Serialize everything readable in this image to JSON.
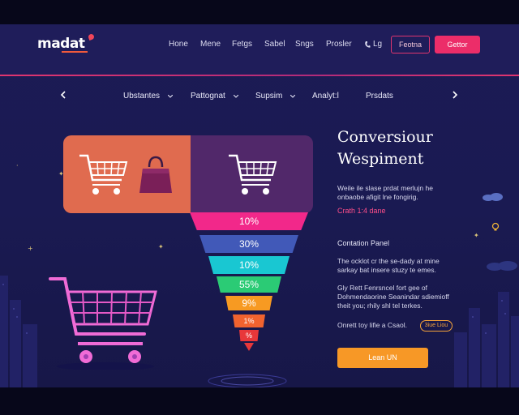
{
  "header": {
    "logo": "madat",
    "nav": [
      "Hone",
      "Mene",
      "Fetgs",
      "Sabel",
      "Sngs",
      "Prosler"
    ],
    "login_label": "Lg",
    "outline_button": "Feotna",
    "solid_button": "Gettor"
  },
  "subnav": {
    "items": [
      "Ubstantes",
      "Pattognat",
      "Supsim",
      "Analyt:l",
      "Prsdats"
    ]
  },
  "funnel": {
    "stages": [
      {
        "label": "10%",
        "value": 10,
        "color": "#f2288a"
      },
      {
        "label": "30%",
        "value": 30,
        "color": "#4159b8"
      },
      {
        "label": "10%",
        "value": 10,
        "color": "#19c7d2"
      },
      {
        "label": "55%",
        "value": 55,
        "color": "#2bcb75"
      },
      {
        "label": "9%",
        "value": 9,
        "color": "#f79a22"
      },
      {
        "label": "1%",
        "value": 1,
        "color": "#f1632f"
      },
      {
        "label": "%",
        "value": null,
        "color": "#e8373a"
      }
    ]
  },
  "content": {
    "title_line1": "Conversiour",
    "title_line2": "Wespiment",
    "intro_line1": "Weile ile slase prdat merlujn he",
    "intro_line2": "onbaobe afigit lne fongirig.",
    "link": "Crath 1:4 dane",
    "section_label": "Contation Panel",
    "para1_line1": "The ocklot cr the se-dady at mine",
    "para1_line2": "sarkay bat insere stuzy te emes.",
    "para2_line1": "Gly Rett Fenrsncel fort gee of",
    "para2_line2": "Dohmendaorine Seanindar sdiemioff",
    "para2_line3": "theit you; rhily shl tel terkes.",
    "footnote": "Onrett toy lifie a Csaol.",
    "tag": "3iue Liou",
    "cta": "Lean UN"
  },
  "colors": {
    "accent_pink": "#ec2d69",
    "cta_orange": "#f79826",
    "background": "#1c1b55"
  },
  "icons": [
    "cart-icon",
    "bag-icon",
    "chevron-left-icon",
    "chevron-right-icon",
    "chevron-down-icon",
    "phone-icon"
  ]
}
